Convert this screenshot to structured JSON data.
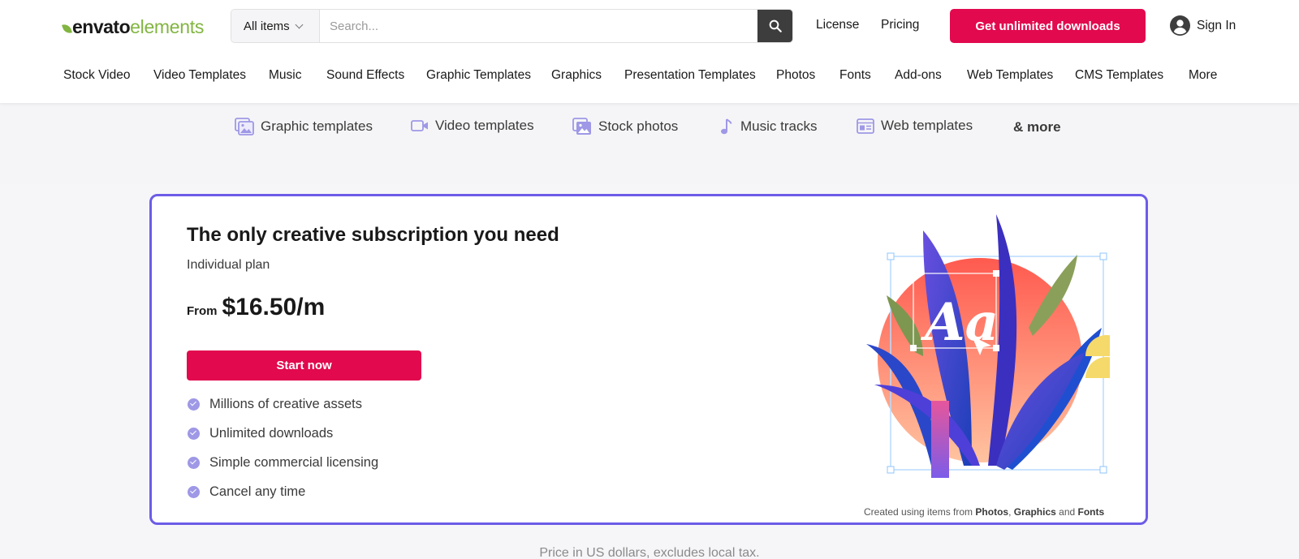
{
  "brand": {
    "name_bold": "envato",
    "name_light": "elements",
    "accent": "#82b541"
  },
  "search": {
    "category": "All items",
    "placeholder": "Search..."
  },
  "header": {
    "license": "License",
    "pricing": "Pricing",
    "cta": "Get unlimited downloads",
    "sign_in": "Sign In",
    "cta_color": "#e2094e"
  },
  "categories": [
    "Stock Video",
    "Video Templates",
    "Music",
    "Sound Effects",
    "Graphic Templates",
    "Graphics",
    "Presentation Templates",
    "Photos",
    "Fonts",
    "Add-ons",
    "Web Templates",
    "CMS Templates",
    "More"
  ],
  "subnav": {
    "items": [
      {
        "label": "Graphic templates",
        "icon": "image-stack-icon"
      },
      {
        "label": "Video templates",
        "icon": "video-camera-icon"
      },
      {
        "label": "Stock photos",
        "icon": "photo-icon"
      },
      {
        "label": "Music tracks",
        "icon": "music-note-icon"
      },
      {
        "label": "Web templates",
        "icon": "browser-window-icon"
      }
    ],
    "more": "& more"
  },
  "plan_card": {
    "title": "The only creative subscription you need",
    "plan": "Individual plan",
    "price_prefix": "From",
    "price": "$16.50/m",
    "button": "Start now",
    "features": [
      "Millions of creative assets",
      "Unlimited downloads",
      "Simple commercial licensing",
      "Cancel any time"
    ],
    "credit_prefix": "Created using items from",
    "credit_a": "Photos",
    "credit_sep": ",",
    "credit_b": "Graphics",
    "credit_and": "and",
    "credit_c": "Fonts",
    "art_text": "Aa",
    "border_color": "#6c5ce7"
  },
  "footnote": "Price in US dollars, excludes local tax."
}
